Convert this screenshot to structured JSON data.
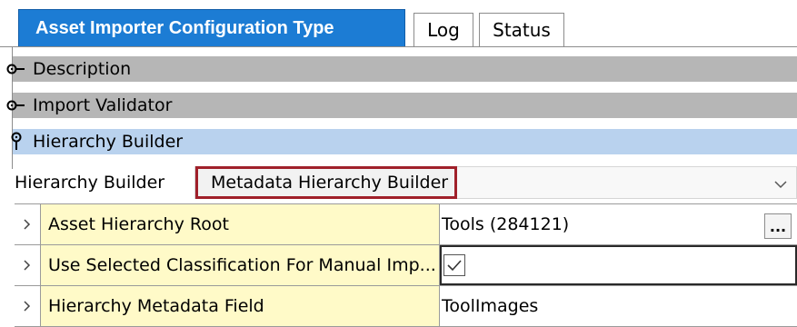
{
  "tabs": {
    "active_label": "Asset Importer Configuration Type",
    "log_label": "Log",
    "status_label": "Status"
  },
  "sections": [
    {
      "label": "Description",
      "icon": "key-collapsed-icon",
      "state": "collapsed"
    },
    {
      "label": "Import Validator",
      "icon": "key-collapsed-icon",
      "state": "collapsed"
    },
    {
      "label": "Hierarchy Builder",
      "icon": "key-expanded-icon",
      "state": "expanded"
    }
  ],
  "hierarchy_builder": {
    "label": "Hierarchy Builder",
    "value": "Metadata Hierarchy Builder"
  },
  "properties": [
    {
      "name": "Asset Hierarchy Root",
      "value": "Tools (284121)",
      "has_browse": true,
      "browse_label": "..."
    },
    {
      "name": "Use Selected Classification For Manual Imp...",
      "value": "",
      "checked": true
    },
    {
      "name": "Hierarchy Metadata Field",
      "value": "ToolImages"
    }
  ],
  "colors": {
    "active_tab": "#1c7cd4",
    "collapsed_section": "#b6b6b6",
    "expanded_section": "#b9d2ee",
    "property_name_bg": "#fffac8",
    "highlight_border": "#a0202a"
  }
}
